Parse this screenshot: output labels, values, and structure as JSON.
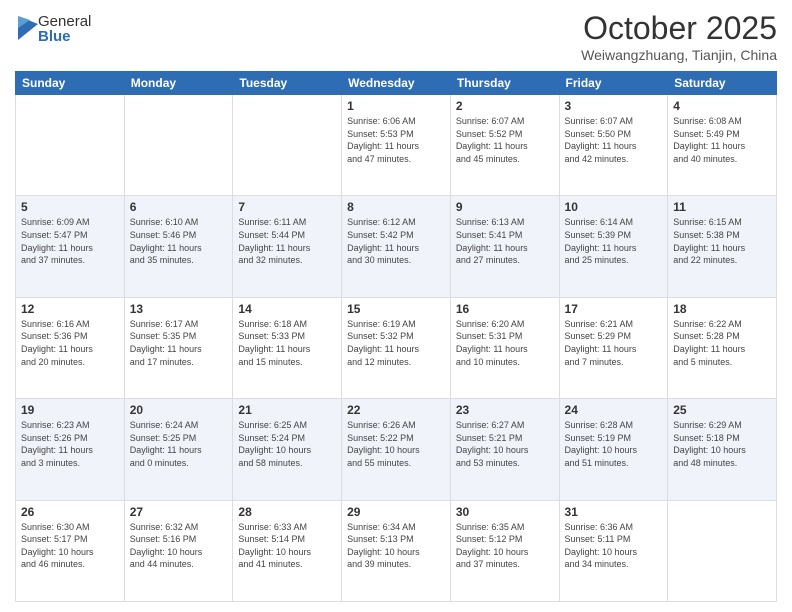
{
  "logo": {
    "general": "General",
    "blue": "Blue"
  },
  "title": "October 2025",
  "location": "Weiwangzhuang, Tianjin, China",
  "headers": [
    "Sunday",
    "Monday",
    "Tuesday",
    "Wednesday",
    "Thursday",
    "Friday",
    "Saturday"
  ],
  "weeks": [
    [
      {
        "day": "",
        "info": ""
      },
      {
        "day": "",
        "info": ""
      },
      {
        "day": "",
        "info": ""
      },
      {
        "day": "1",
        "info": "Sunrise: 6:06 AM\nSunset: 5:53 PM\nDaylight: 11 hours\nand 47 minutes."
      },
      {
        "day": "2",
        "info": "Sunrise: 6:07 AM\nSunset: 5:52 PM\nDaylight: 11 hours\nand 45 minutes."
      },
      {
        "day": "3",
        "info": "Sunrise: 6:07 AM\nSunset: 5:50 PM\nDaylight: 11 hours\nand 42 minutes."
      },
      {
        "day": "4",
        "info": "Sunrise: 6:08 AM\nSunset: 5:49 PM\nDaylight: 11 hours\nand 40 minutes."
      }
    ],
    [
      {
        "day": "5",
        "info": "Sunrise: 6:09 AM\nSunset: 5:47 PM\nDaylight: 11 hours\nand 37 minutes."
      },
      {
        "day": "6",
        "info": "Sunrise: 6:10 AM\nSunset: 5:46 PM\nDaylight: 11 hours\nand 35 minutes."
      },
      {
        "day": "7",
        "info": "Sunrise: 6:11 AM\nSunset: 5:44 PM\nDaylight: 11 hours\nand 32 minutes."
      },
      {
        "day": "8",
        "info": "Sunrise: 6:12 AM\nSunset: 5:42 PM\nDaylight: 11 hours\nand 30 minutes."
      },
      {
        "day": "9",
        "info": "Sunrise: 6:13 AM\nSunset: 5:41 PM\nDaylight: 11 hours\nand 27 minutes."
      },
      {
        "day": "10",
        "info": "Sunrise: 6:14 AM\nSunset: 5:39 PM\nDaylight: 11 hours\nand 25 minutes."
      },
      {
        "day": "11",
        "info": "Sunrise: 6:15 AM\nSunset: 5:38 PM\nDaylight: 11 hours\nand 22 minutes."
      }
    ],
    [
      {
        "day": "12",
        "info": "Sunrise: 6:16 AM\nSunset: 5:36 PM\nDaylight: 11 hours\nand 20 minutes."
      },
      {
        "day": "13",
        "info": "Sunrise: 6:17 AM\nSunset: 5:35 PM\nDaylight: 11 hours\nand 17 minutes."
      },
      {
        "day": "14",
        "info": "Sunrise: 6:18 AM\nSunset: 5:33 PM\nDaylight: 11 hours\nand 15 minutes."
      },
      {
        "day": "15",
        "info": "Sunrise: 6:19 AM\nSunset: 5:32 PM\nDaylight: 11 hours\nand 12 minutes."
      },
      {
        "day": "16",
        "info": "Sunrise: 6:20 AM\nSunset: 5:31 PM\nDaylight: 11 hours\nand 10 minutes."
      },
      {
        "day": "17",
        "info": "Sunrise: 6:21 AM\nSunset: 5:29 PM\nDaylight: 11 hours\nand 7 minutes."
      },
      {
        "day": "18",
        "info": "Sunrise: 6:22 AM\nSunset: 5:28 PM\nDaylight: 11 hours\nand 5 minutes."
      }
    ],
    [
      {
        "day": "19",
        "info": "Sunrise: 6:23 AM\nSunset: 5:26 PM\nDaylight: 11 hours\nand 3 minutes."
      },
      {
        "day": "20",
        "info": "Sunrise: 6:24 AM\nSunset: 5:25 PM\nDaylight: 11 hours\nand 0 minutes."
      },
      {
        "day": "21",
        "info": "Sunrise: 6:25 AM\nSunset: 5:24 PM\nDaylight: 10 hours\nand 58 minutes."
      },
      {
        "day": "22",
        "info": "Sunrise: 6:26 AM\nSunset: 5:22 PM\nDaylight: 10 hours\nand 55 minutes."
      },
      {
        "day": "23",
        "info": "Sunrise: 6:27 AM\nSunset: 5:21 PM\nDaylight: 10 hours\nand 53 minutes."
      },
      {
        "day": "24",
        "info": "Sunrise: 6:28 AM\nSunset: 5:19 PM\nDaylight: 10 hours\nand 51 minutes."
      },
      {
        "day": "25",
        "info": "Sunrise: 6:29 AM\nSunset: 5:18 PM\nDaylight: 10 hours\nand 48 minutes."
      }
    ],
    [
      {
        "day": "26",
        "info": "Sunrise: 6:30 AM\nSunset: 5:17 PM\nDaylight: 10 hours\nand 46 minutes."
      },
      {
        "day": "27",
        "info": "Sunrise: 6:32 AM\nSunset: 5:16 PM\nDaylight: 10 hours\nand 44 minutes."
      },
      {
        "day": "28",
        "info": "Sunrise: 6:33 AM\nSunset: 5:14 PM\nDaylight: 10 hours\nand 41 minutes."
      },
      {
        "day": "29",
        "info": "Sunrise: 6:34 AM\nSunset: 5:13 PM\nDaylight: 10 hours\nand 39 minutes."
      },
      {
        "day": "30",
        "info": "Sunrise: 6:35 AM\nSunset: 5:12 PM\nDaylight: 10 hours\nand 37 minutes."
      },
      {
        "day": "31",
        "info": "Sunrise: 6:36 AM\nSunset: 5:11 PM\nDaylight: 10 hours\nand 34 minutes."
      },
      {
        "day": "",
        "info": ""
      }
    ]
  ]
}
